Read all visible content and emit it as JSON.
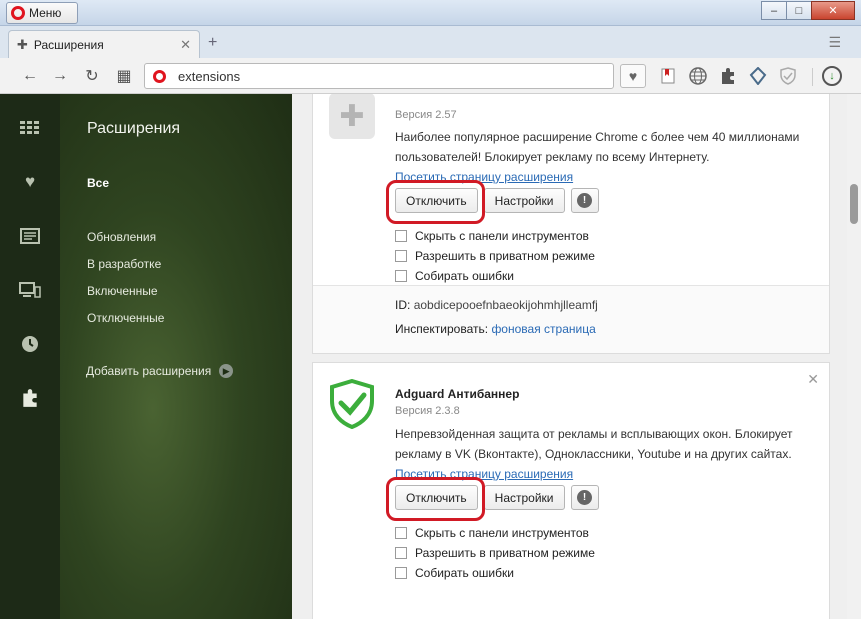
{
  "window": {
    "menu_label": "Меню",
    "min": "–",
    "max": "□",
    "close": "✕"
  },
  "tab": {
    "title": "Расширения",
    "close": "✕",
    "new_tab": "+",
    "menu": "☰"
  },
  "address": {
    "url": "extensions",
    "back": "←",
    "forward": "→",
    "reload": "↻",
    "grid": "▦",
    "heart": "♥"
  },
  "toolbar_icons": [
    "bookmark-icon",
    "globe-icon",
    "puzzle-icon",
    "opera-shield-icon",
    "adguard-icon"
  ],
  "sidebar": {
    "title": "Расширения",
    "items": [
      {
        "label": "Все",
        "active": true
      },
      {
        "label": "Обновления"
      },
      {
        "label": "В разработке"
      },
      {
        "label": "Включенные"
      },
      {
        "label": "Отключенные"
      }
    ],
    "add_label": "Добавить расширения",
    "add_arrow": "▶"
  },
  "extensions": [
    {
      "version": "Версия 2.57",
      "description": "Наиболее популярное расширение Chrome с более чем 40 миллионами пользователей! Блокирует рекламу по всему Интернету.",
      "link": "Посетить страницу расширения",
      "disable": "Отключить",
      "settings": "Настройки",
      "warn": "!",
      "options": [
        "Скрыть с панели инструментов",
        "Разрешить в приватном режиме",
        "Собирать ошибки"
      ],
      "id_label": "ID:",
      "id_value": "aobdicepooefnbaeokijohmhjlleamfj",
      "inspect_label": "Инспектировать:",
      "inspect_link": "фоновая страница"
    },
    {
      "name": "Adguard Антибаннер",
      "version": "Версия 2.3.8",
      "description": "Непревзойденная защита от рекламы и всплывающих окон. Блокирует рекламу в VK (Вконтакте), Одноклассники, Youtube и на других сайтах.",
      "link": "Посетить страницу расширения",
      "disable": "Отключить",
      "settings": "Настройки",
      "warn": "!",
      "close": "✕",
      "options": [
        "Скрыть с панели инструментов",
        "Разрешить в приватном режиме",
        "Собирать ошибки"
      ]
    }
  ],
  "colors": {
    "highlight": "#d11a25",
    "link": "#2a6ab5",
    "adguard_green": "#3cae3c"
  }
}
